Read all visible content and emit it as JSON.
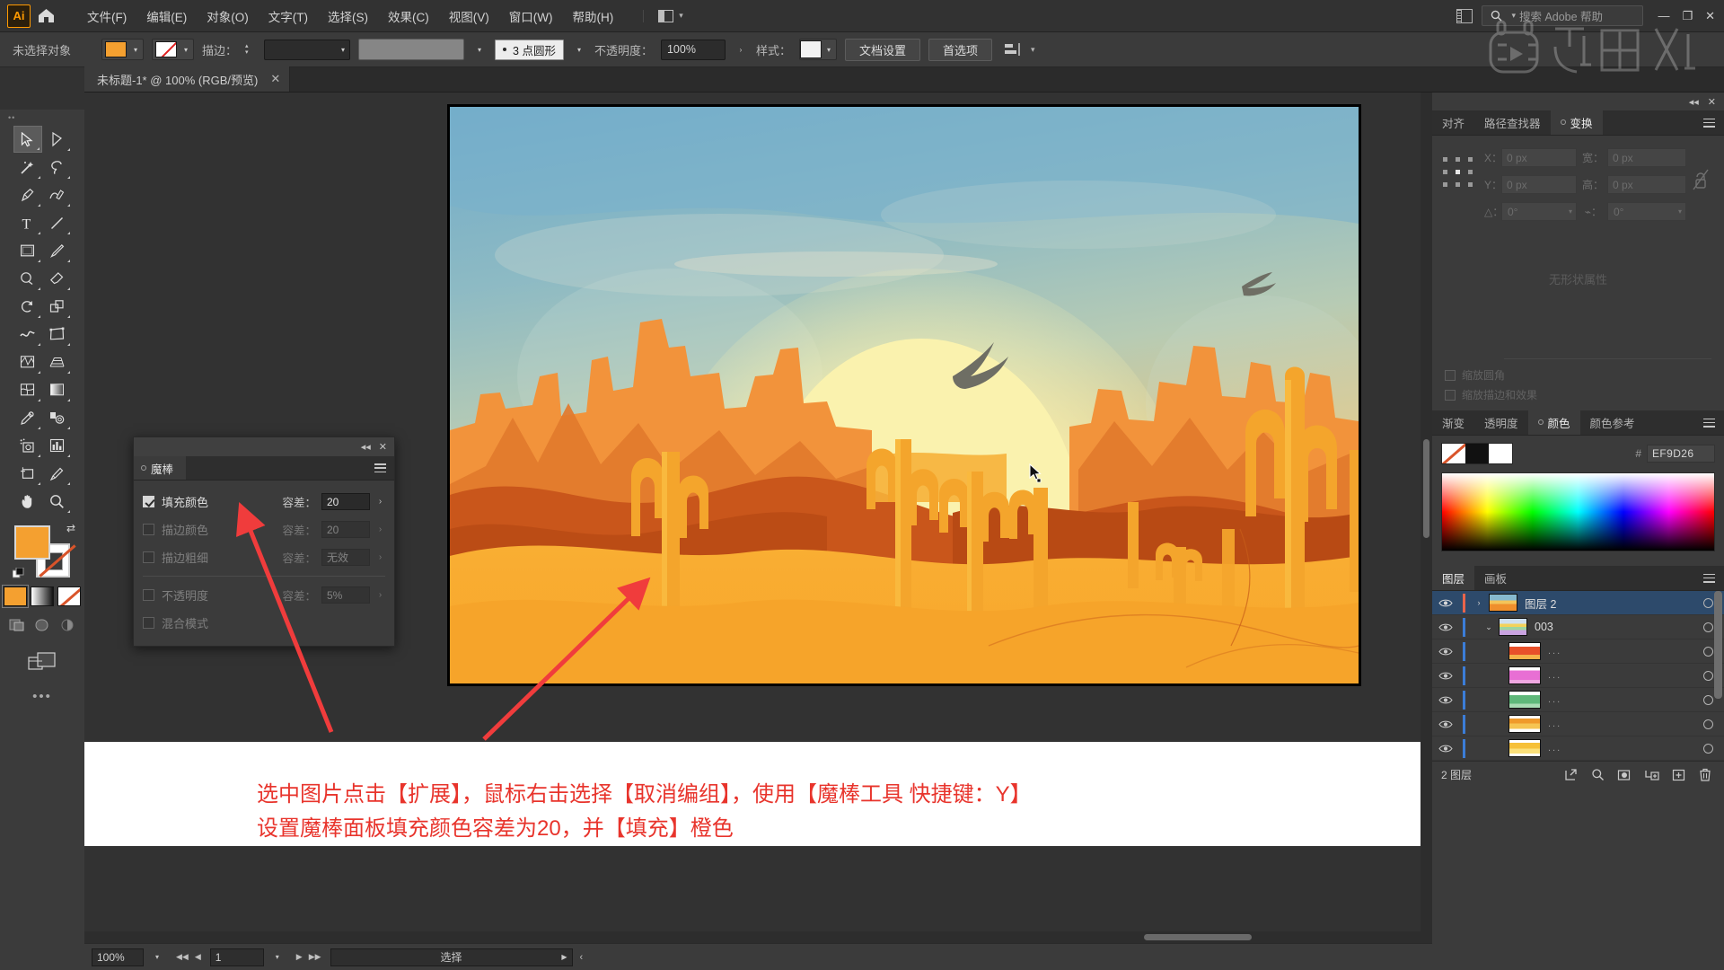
{
  "app": {
    "logo": "Ai",
    "home_icon": "home-icon",
    "search_placeholder": "搜索 Adobe 帮助",
    "window_minimize": "—",
    "window_restore": "❐",
    "window_close": "✕"
  },
  "menu": {
    "items": [
      "文件(F)",
      "编辑(E)",
      "对象(O)",
      "文字(T)",
      "选择(S)",
      "效果(C)",
      "视图(V)",
      "窗口(W)",
      "帮助(H)"
    ]
  },
  "control_bar": {
    "selection_label": "未选择对象",
    "fill_color": "#F4A030",
    "stroke_color": "none",
    "stroke_label": "描边：",
    "stroke_weight": "",
    "profile": "",
    "brush_label": "3 点圆形",
    "opacity_label": "不透明度：",
    "opacity_value": "100%",
    "style_label": "样式：",
    "doc_setup_button": "文档设置",
    "preferences_button": "首选项"
  },
  "document_tab": {
    "title": "未标题-1* @ 100% (RGB/预览)",
    "close": "✕"
  },
  "toolbar": {
    "tools": [
      "selection-tool",
      "direct-selection-tool",
      "magic-wand-tool",
      "lasso-tool",
      "pen-tool",
      "curvature-tool",
      "type-tool",
      "line-segment-tool",
      "rectangle-tool",
      "paintbrush-tool",
      "shaper-tool",
      "eraser-tool",
      "rotate-tool",
      "scale-tool",
      "width-tool",
      "free-transform-tool",
      "shape-builder-tool",
      "perspective-grid-tool",
      "mesh-tool",
      "gradient-tool",
      "eyedropper-tool",
      "blend-tool",
      "symbol-sprayer-tool",
      "column-graph-tool",
      "artboard-tool",
      "slice-tool",
      "hand-tool",
      "zoom-tool"
    ],
    "fill_swatch": "#F4A030",
    "stroke_swatch": "none",
    "modes": [
      "color-mode",
      "gradient-mode",
      "none-mode"
    ],
    "more_tools": "•••"
  },
  "magic_wand_panel": {
    "tab_label": "魔棒",
    "close": "✕",
    "collapse": "◂◂",
    "rows": [
      {
        "label": "填充颜色",
        "checked": true,
        "tolerance_label": "容差：",
        "tolerance_value": "20",
        "enabled": true
      },
      {
        "label": "描边颜色",
        "checked": false,
        "tolerance_label": "容差：",
        "tolerance_value": "20",
        "enabled": false
      },
      {
        "label": "描边粗细",
        "checked": false,
        "tolerance_label": "容差：",
        "tolerance_value": "无效",
        "enabled": false
      },
      {
        "label": "不透明度",
        "checked": false,
        "tolerance_label": "容差：",
        "tolerance_value": "5%",
        "enabled": false
      },
      {
        "label": "混合模式",
        "checked": false,
        "tolerance_label": "",
        "tolerance_value": "",
        "enabled": false
      }
    ]
  },
  "artwork": {
    "title": "desert-sunset-illustration",
    "sky_top": "#7FB2CC",
    "sky_mid": "#A9C6C0",
    "sun": "#FAF0A8",
    "sand": "#F6A22A",
    "mesa_dark": "#C8561A",
    "cactus": "#F5A62B"
  },
  "caption": {
    "line1": "选中图片点击【扩展】，鼠标右击选择【取消编组】，使用【魔棒工具 快捷键：Y】",
    "line2": "设置魔棒面板填充颜色容差为20，并【填充】橙色",
    "color": "#E8342C"
  },
  "status_bar": {
    "zoom": "100%",
    "page": "1",
    "status_text": "选择",
    "first_icon": "◀◀",
    "prev_icon": "◀",
    "next_icon": "▶",
    "last_icon": "▶▶"
  },
  "right_panels": {
    "transform": {
      "tabs": [
        "对齐",
        "路径查找器",
        "变换"
      ],
      "selected_tab": "变换",
      "x_label": "X：",
      "x_value": "0 px",
      "y_label": "Y：",
      "y_value": "0 px",
      "w_label": "宽：",
      "w_value": "0 px",
      "h_label": "高：",
      "h_value": "0 px",
      "angle_label": "△：",
      "angle_value": "0°",
      "shear_label": "⌁：",
      "shear_value": "0°",
      "empty_text": "无形状属性",
      "scale_corners": "缩放圆角",
      "scale_strokes": "缩放描边和效果",
      "close": "✕",
      "collapse": "◂◂"
    },
    "color": {
      "tabs": [
        "渐变",
        "透明度",
        "颜色",
        "颜色参考"
      ],
      "selected_tab": "颜色",
      "hash": "#",
      "hex_value": "EF9D26",
      "swatches": [
        "none",
        "#111111",
        "#FFFFFF"
      ]
    },
    "layers": {
      "tabs": [
        "图层",
        "画板"
      ],
      "selected_tab": "图层",
      "rows": [
        {
          "name": "图层 2",
          "selected": true,
          "indent": 0,
          "expander": "›",
          "bar_color": "#E8644B",
          "thumb": "artwork",
          "has_dots": false
        },
        {
          "name": "003",
          "selected": false,
          "indent": 1,
          "expander": "⌄",
          "bar_color": "#3B7DD8",
          "thumb": "group",
          "has_dots": false
        },
        {
          "name": "...",
          "selected": false,
          "indent": 2,
          "expander": "",
          "bar_color": "#3B7DD8",
          "thumb": "red",
          "has_dots": true
        },
        {
          "name": "...",
          "selected": false,
          "indent": 2,
          "expander": "",
          "bar_color": "#3B7DD8",
          "thumb": "magenta",
          "has_dots": true
        },
        {
          "name": "...",
          "selected": false,
          "indent": 2,
          "expander": "",
          "bar_color": "#3B7DD8",
          "thumb": "green",
          "has_dots": true
        },
        {
          "name": "...",
          "selected": false,
          "indent": 2,
          "expander": "",
          "bar_color": "#3B7DD8",
          "thumb": "orange",
          "has_dots": true
        },
        {
          "name": "...",
          "selected": false,
          "indent": 2,
          "expander": "",
          "bar_color": "#3B7DD8",
          "thumb": "yellow",
          "has_dots": true
        }
      ],
      "footer_count": "2 图层",
      "footer_buttons": [
        "locate-object",
        "search",
        "make-clipping-mask",
        "create-sublayer",
        "create-new-layer",
        "delete-selection"
      ]
    }
  }
}
